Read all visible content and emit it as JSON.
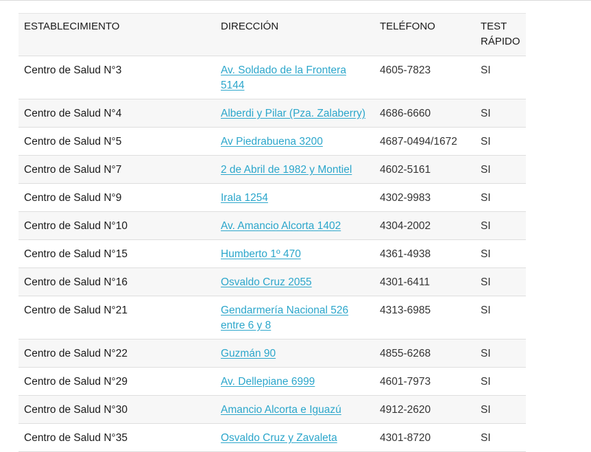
{
  "table": {
    "headers": {
      "establecimiento": "ESTABLECIMIENTO",
      "direccion": "DIRECCIÓN",
      "telefono": "TELÉFONO",
      "test_rapido": "TEST RÁPIDO"
    },
    "rows": [
      {
        "name": "Centro de Salud N°3",
        "address": "Av. Soldado de la Frontera 5144",
        "phone": "4605-7823",
        "test": "SI"
      },
      {
        "name": "Centro de Salud N°4",
        "address": "Alberdi y Pilar (Pza. Zalaberry)",
        "phone": "4686-6660",
        "test": "SI"
      },
      {
        "name": "Centro de Salud N°5",
        "address": "Av Piedrabuena 3200",
        "phone": "4687-0494/1672",
        "test": "SI"
      },
      {
        "name": "Centro de Salud N°7",
        "address": "2 de Abril de 1982 y Montiel",
        "phone": "4602-5161",
        "test": "SI"
      },
      {
        "name": "Centro de Salud N°9",
        "address": "Irala 1254",
        "phone": "4302-9983",
        "test": "SI"
      },
      {
        "name": "Centro de Salud N°10",
        "address": "Av. Amancio Alcorta 1402",
        "phone": "4304-2002",
        "test": "SI"
      },
      {
        "name": "Centro de Salud N°15",
        "address": "Humberto 1º 470",
        "phone": "4361-4938",
        "test": "SI"
      },
      {
        "name": "Centro de Salud N°16",
        "address": "Osvaldo Cruz 2055",
        "phone": "4301-6411",
        "test": "SI"
      },
      {
        "name": "Centro de Salud N°21",
        "address": "Gendarmería Nacional 526 entre 6 y 8",
        "phone": "4313-6985",
        "test": "SI"
      },
      {
        "name": "Centro de Salud N°22",
        "address": "Guzmán 90",
        "phone": "4855-6268",
        "test": "SI"
      },
      {
        "name": "Centro de Salud N°29",
        "address": "Av. Dellepiane 6999",
        "phone": "4601-7973",
        "test": "SI"
      },
      {
        "name": "Centro de Salud N°30",
        "address": "Amancio Alcorta e Iguazú",
        "phone": "4912-2620",
        "test": "SI"
      },
      {
        "name": "Centro de Salud N°35",
        "address": "Osvaldo Cruz y Zavaleta",
        "phone": "4301-8720",
        "test": "SI"
      }
    ]
  },
  "colors": {
    "link": "#2ba6cb",
    "row_alt": "#f7f7f7",
    "border": "#dedede"
  }
}
